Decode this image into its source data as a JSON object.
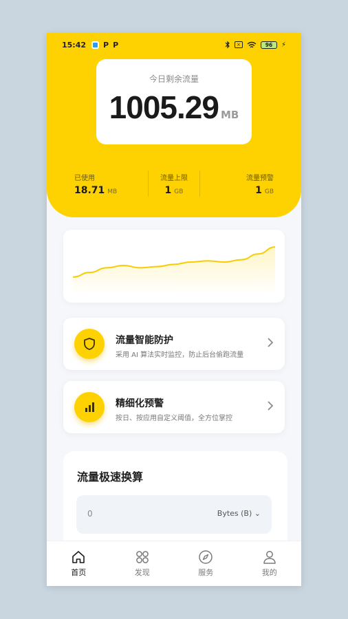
{
  "status_bar": {
    "time": "15:42",
    "p1": "P",
    "p2": "P",
    "battery": "96",
    "sim_icon": "×",
    "bluetooth_icon": "bluetooth-icon",
    "wifi_icon": "wifi-icon"
  },
  "remaining": {
    "label": "今日剩余流量",
    "value": "1005.29",
    "unit": "MB"
  },
  "stats": {
    "used": {
      "label": "已使用",
      "value": "18.71",
      "unit": "MB"
    },
    "limit": {
      "label": "流量上限",
      "value": "1",
      "unit": "GB"
    },
    "warning": {
      "label": "流量预警",
      "value": "1",
      "unit": "GB"
    }
  },
  "chart_data": {
    "type": "area",
    "x": [
      0,
      1,
      2,
      3,
      4,
      5,
      6,
      7,
      8,
      9,
      10,
      11,
      12
    ],
    "values": [
      30,
      38,
      46,
      50,
      46,
      48,
      52,
      56,
      58,
      56,
      60,
      70,
      82
    ],
    "ylim": [
      0,
      100
    ],
    "color": "#fed200",
    "grid": false
  },
  "features": [
    {
      "title": "流量智能防护",
      "desc": "采用 AI 算法实时监控，防止后台偷跑流量",
      "icon": "shield-icon"
    },
    {
      "title": "精细化预警",
      "desc": "按日、按应用自定义阈值，全方位掌控",
      "icon": "bar-chart-icon"
    }
  ],
  "converter": {
    "title": "流量极速换算",
    "value": "0",
    "unit": "Bytes (B)"
  },
  "tabs": [
    {
      "label": "首页",
      "icon": "home-icon",
      "active": true
    },
    {
      "label": "发现",
      "icon": "grid-icon",
      "active": false
    },
    {
      "label": "服务",
      "icon": "compass-icon",
      "active": false
    },
    {
      "label": "我的",
      "icon": "user-icon",
      "active": false
    }
  ],
  "colors": {
    "accent": "#fed200",
    "background": "#f5f7fb"
  }
}
